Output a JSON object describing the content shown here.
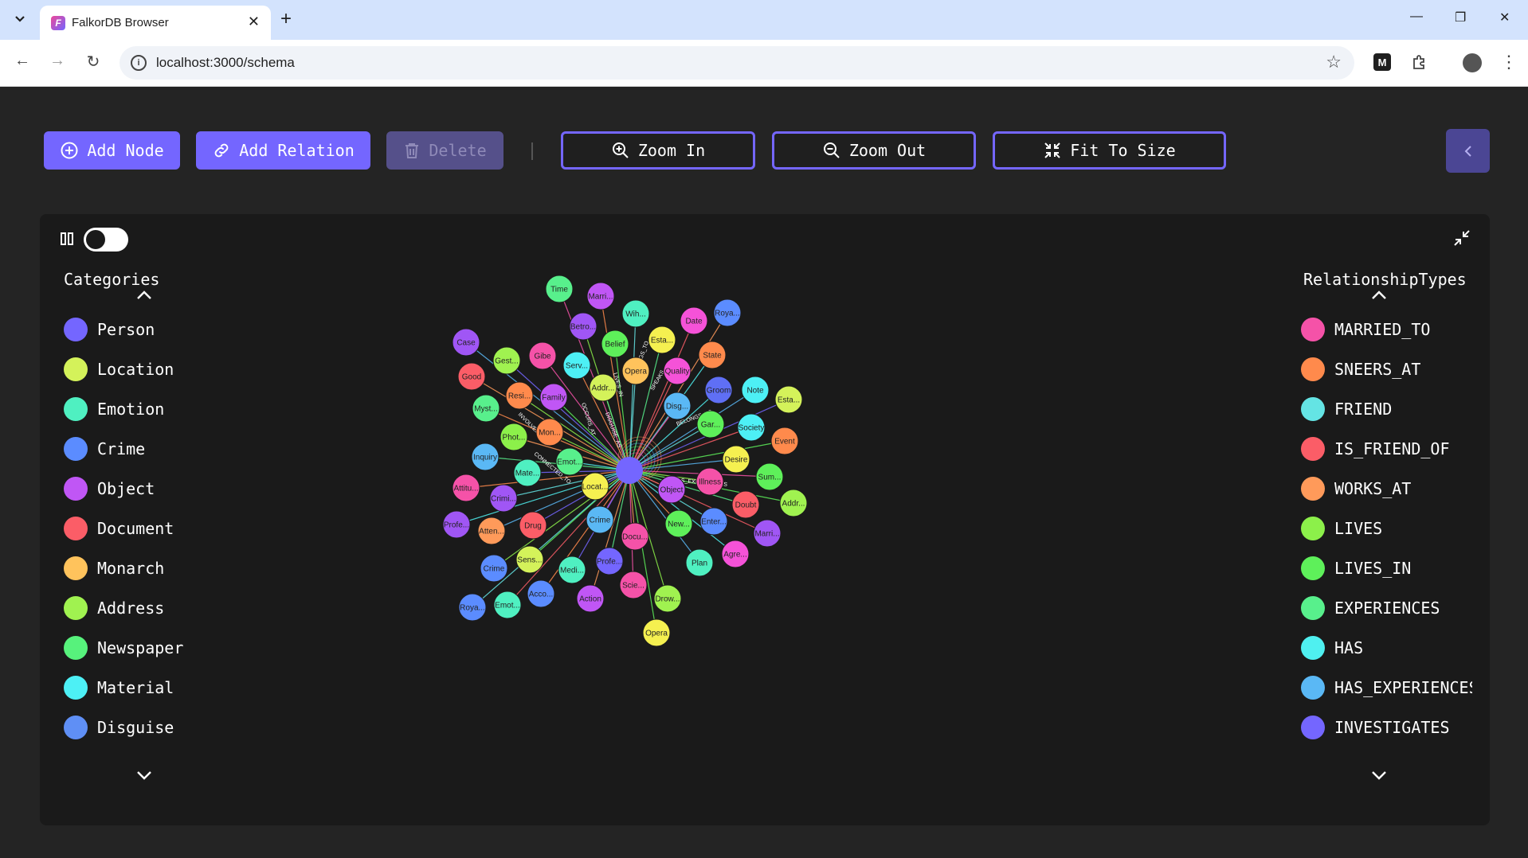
{
  "browser": {
    "tab_title": "FalkorDB Browser",
    "favicon_letter": "F",
    "url": "localhost:3000/schema",
    "ext_letter": "M"
  },
  "toolbar": {
    "add_node": "Add Node",
    "add_relation": "Add Relation",
    "delete": "Delete",
    "zoom_in": "Zoom In",
    "zoom_out": "Zoom Out",
    "fit_to_size": "Fit To Size"
  },
  "categories": {
    "title": "Categories",
    "items": [
      {
        "label": "Person",
        "color": "#7466ff"
      },
      {
        "label": "Location",
        "color": "#d4f25a"
      },
      {
        "label": "Emotion",
        "color": "#4ff0c1"
      },
      {
        "label": "Crime",
        "color": "#5b8cff"
      },
      {
        "label": "Object",
        "color": "#c056f5"
      },
      {
        "label": "Document",
        "color": "#fb5d67"
      },
      {
        "label": "Monarch",
        "color": "#ffc35c"
      },
      {
        "label": "Address",
        "color": "#a0f250"
      },
      {
        "label": "Newspaper",
        "color": "#57f27c"
      },
      {
        "label": "Material",
        "color": "#4df0f5"
      },
      {
        "label": "Disguise",
        "color": "#5f8ff5"
      }
    ]
  },
  "relationships": {
    "title": "RelationshipTypes",
    "items": [
      {
        "label": "MARRIED_TO",
        "color": "#f552a8"
      },
      {
        "label": "SNEERS_AT",
        "color": "#ff8a4c"
      },
      {
        "label": "FRIEND",
        "color": "#64e4e4"
      },
      {
        "label": "IS_FRIEND_OF",
        "color": "#fb5d67"
      },
      {
        "label": "WORKS_AT",
        "color": "#ff9a5a"
      },
      {
        "label": "LIVES",
        "color": "#8cf04a"
      },
      {
        "label": "LIVES_IN",
        "color": "#5ef05a"
      },
      {
        "label": "EXPERIENCES",
        "color": "#58f08c"
      },
      {
        "label": "HAS",
        "color": "#4ff0f0"
      },
      {
        "label": "HAS_EXPERIENCES",
        "color": "#5ab8f5"
      },
      {
        "label": "INVESTIGATES",
        "color": "#7466ff"
      }
    ]
  },
  "graph": {
    "center_color": "#7466ff",
    "nodes": [
      {
        "label": "Time",
        "color": "#58f08c"
      },
      {
        "label": "Marri...",
        "color": "#c056f5"
      },
      {
        "label": "Wih...",
        "color": "#4ff0c1"
      },
      {
        "label": "Date",
        "color": "#f552d8"
      },
      {
        "label": "Roya...",
        "color": "#5b8cff"
      },
      {
        "label": "Betro...",
        "color": "#a056f5"
      },
      {
        "label": "Belief",
        "color": "#5ef05a"
      },
      {
        "label": "Esta...",
        "color": "#f5f050"
      },
      {
        "label": "State",
        "color": "#ff8a4c"
      },
      {
        "label": "Case",
        "color": "#a056f5"
      },
      {
        "label": "Gest...",
        "color": "#a0f250"
      },
      {
        "label": "Gibe",
        "color": "#f552a8"
      },
      {
        "label": "Serv...",
        "color": "#4df0f5"
      },
      {
        "label": "Opera",
        "color": "#ffc35c"
      },
      {
        "label": "Quality",
        "color": "#f552d8"
      },
      {
        "label": "Good",
        "color": "#fb5d67"
      },
      {
        "label": "Resi...",
        "color": "#ff8a4c"
      },
      {
        "label": "Family",
        "color": "#c056f5"
      },
      {
        "label": "Addr...",
        "color": "#d4f25a"
      },
      {
        "label": "Groom",
        "color": "#5f6ff5"
      },
      {
        "label": "Note",
        "color": "#4df0f5"
      },
      {
        "label": "Esta...",
        "color": "#d4f25a"
      },
      {
        "label": "Disg...",
        "color": "#5ab8f5"
      },
      {
        "label": "Myst...",
        "color": "#58f08c"
      },
      {
        "label": "Gar...",
        "color": "#5ef05a"
      },
      {
        "label": "Society",
        "color": "#4df0f5"
      },
      {
        "label": "Phot...",
        "color": "#8cf04a"
      },
      {
        "label": "Mon...",
        "color": "#ff8a4c"
      },
      {
        "label": "Event",
        "color": "#ff8a4c"
      },
      {
        "label": "Inquiry",
        "color": "#5ab8f5"
      },
      {
        "label": "Emot...",
        "color": "#58f08c"
      },
      {
        "label": "Desire",
        "color": "#f5f050"
      },
      {
        "label": "Mate...",
        "color": "#4ff0c1"
      },
      {
        "label": "Sum...",
        "color": "#5ef05a"
      },
      {
        "label": "Attitu...",
        "color": "#f552a8"
      },
      {
        "label": "Crimi...",
        "color": "#a056f5"
      },
      {
        "label": "Locat...",
        "color": "#f5f050"
      },
      {
        "label": "Object",
        "color": "#c056f5"
      },
      {
        "label": "Illness",
        "color": "#f552a8"
      },
      {
        "label": "Addr...",
        "color": "#a0f250"
      },
      {
        "label": "Doubt",
        "color": "#fb5d67"
      },
      {
        "label": "Profe...",
        "color": "#a056f5"
      },
      {
        "label": "Atten...",
        "color": "#ff9a5a"
      },
      {
        "label": "Drug",
        "color": "#fb5d67"
      },
      {
        "label": "Crime",
        "color": "#5ab8f5"
      },
      {
        "label": "New...",
        "color": "#5ef05a"
      },
      {
        "label": "Enter...",
        "color": "#5b8cff"
      },
      {
        "label": "Marri...",
        "color": "#a056f5"
      },
      {
        "label": "Docu...",
        "color": "#f552a8"
      },
      {
        "label": "Crime",
        "color": "#5b8cff"
      },
      {
        "label": "Sens...",
        "color": "#d4f25a"
      },
      {
        "label": "Profe...",
        "color": "#7466ff"
      },
      {
        "label": "Agre...",
        "color": "#f552d8"
      },
      {
        "label": "Plan",
        "color": "#4ff0c1"
      },
      {
        "label": "Medi...",
        "color": "#4ff0c1"
      },
      {
        "label": "Scie...",
        "color": "#f552a8"
      },
      {
        "label": "Acco...",
        "color": "#5b8cff"
      },
      {
        "label": "Roya...",
        "color": "#5b8cff"
      },
      {
        "label": "Emot...",
        "color": "#4ff0c1"
      },
      {
        "label": "Action",
        "color": "#c056f5"
      },
      {
        "label": "Drow...",
        "color": "#a0f250"
      },
      {
        "label": "Opera",
        "color": "#f5f050"
      }
    ],
    "edge_labels": [
      "OCCURS_AT",
      "DISGUISE_AS",
      "LIVES_IN",
      "BELONGS_TO",
      "SPEAKS",
      "BELONGS_TO",
      "INVOLVED_IN",
      "CONNECTED_TO",
      "HAS_EXPERIENCES"
    ]
  }
}
